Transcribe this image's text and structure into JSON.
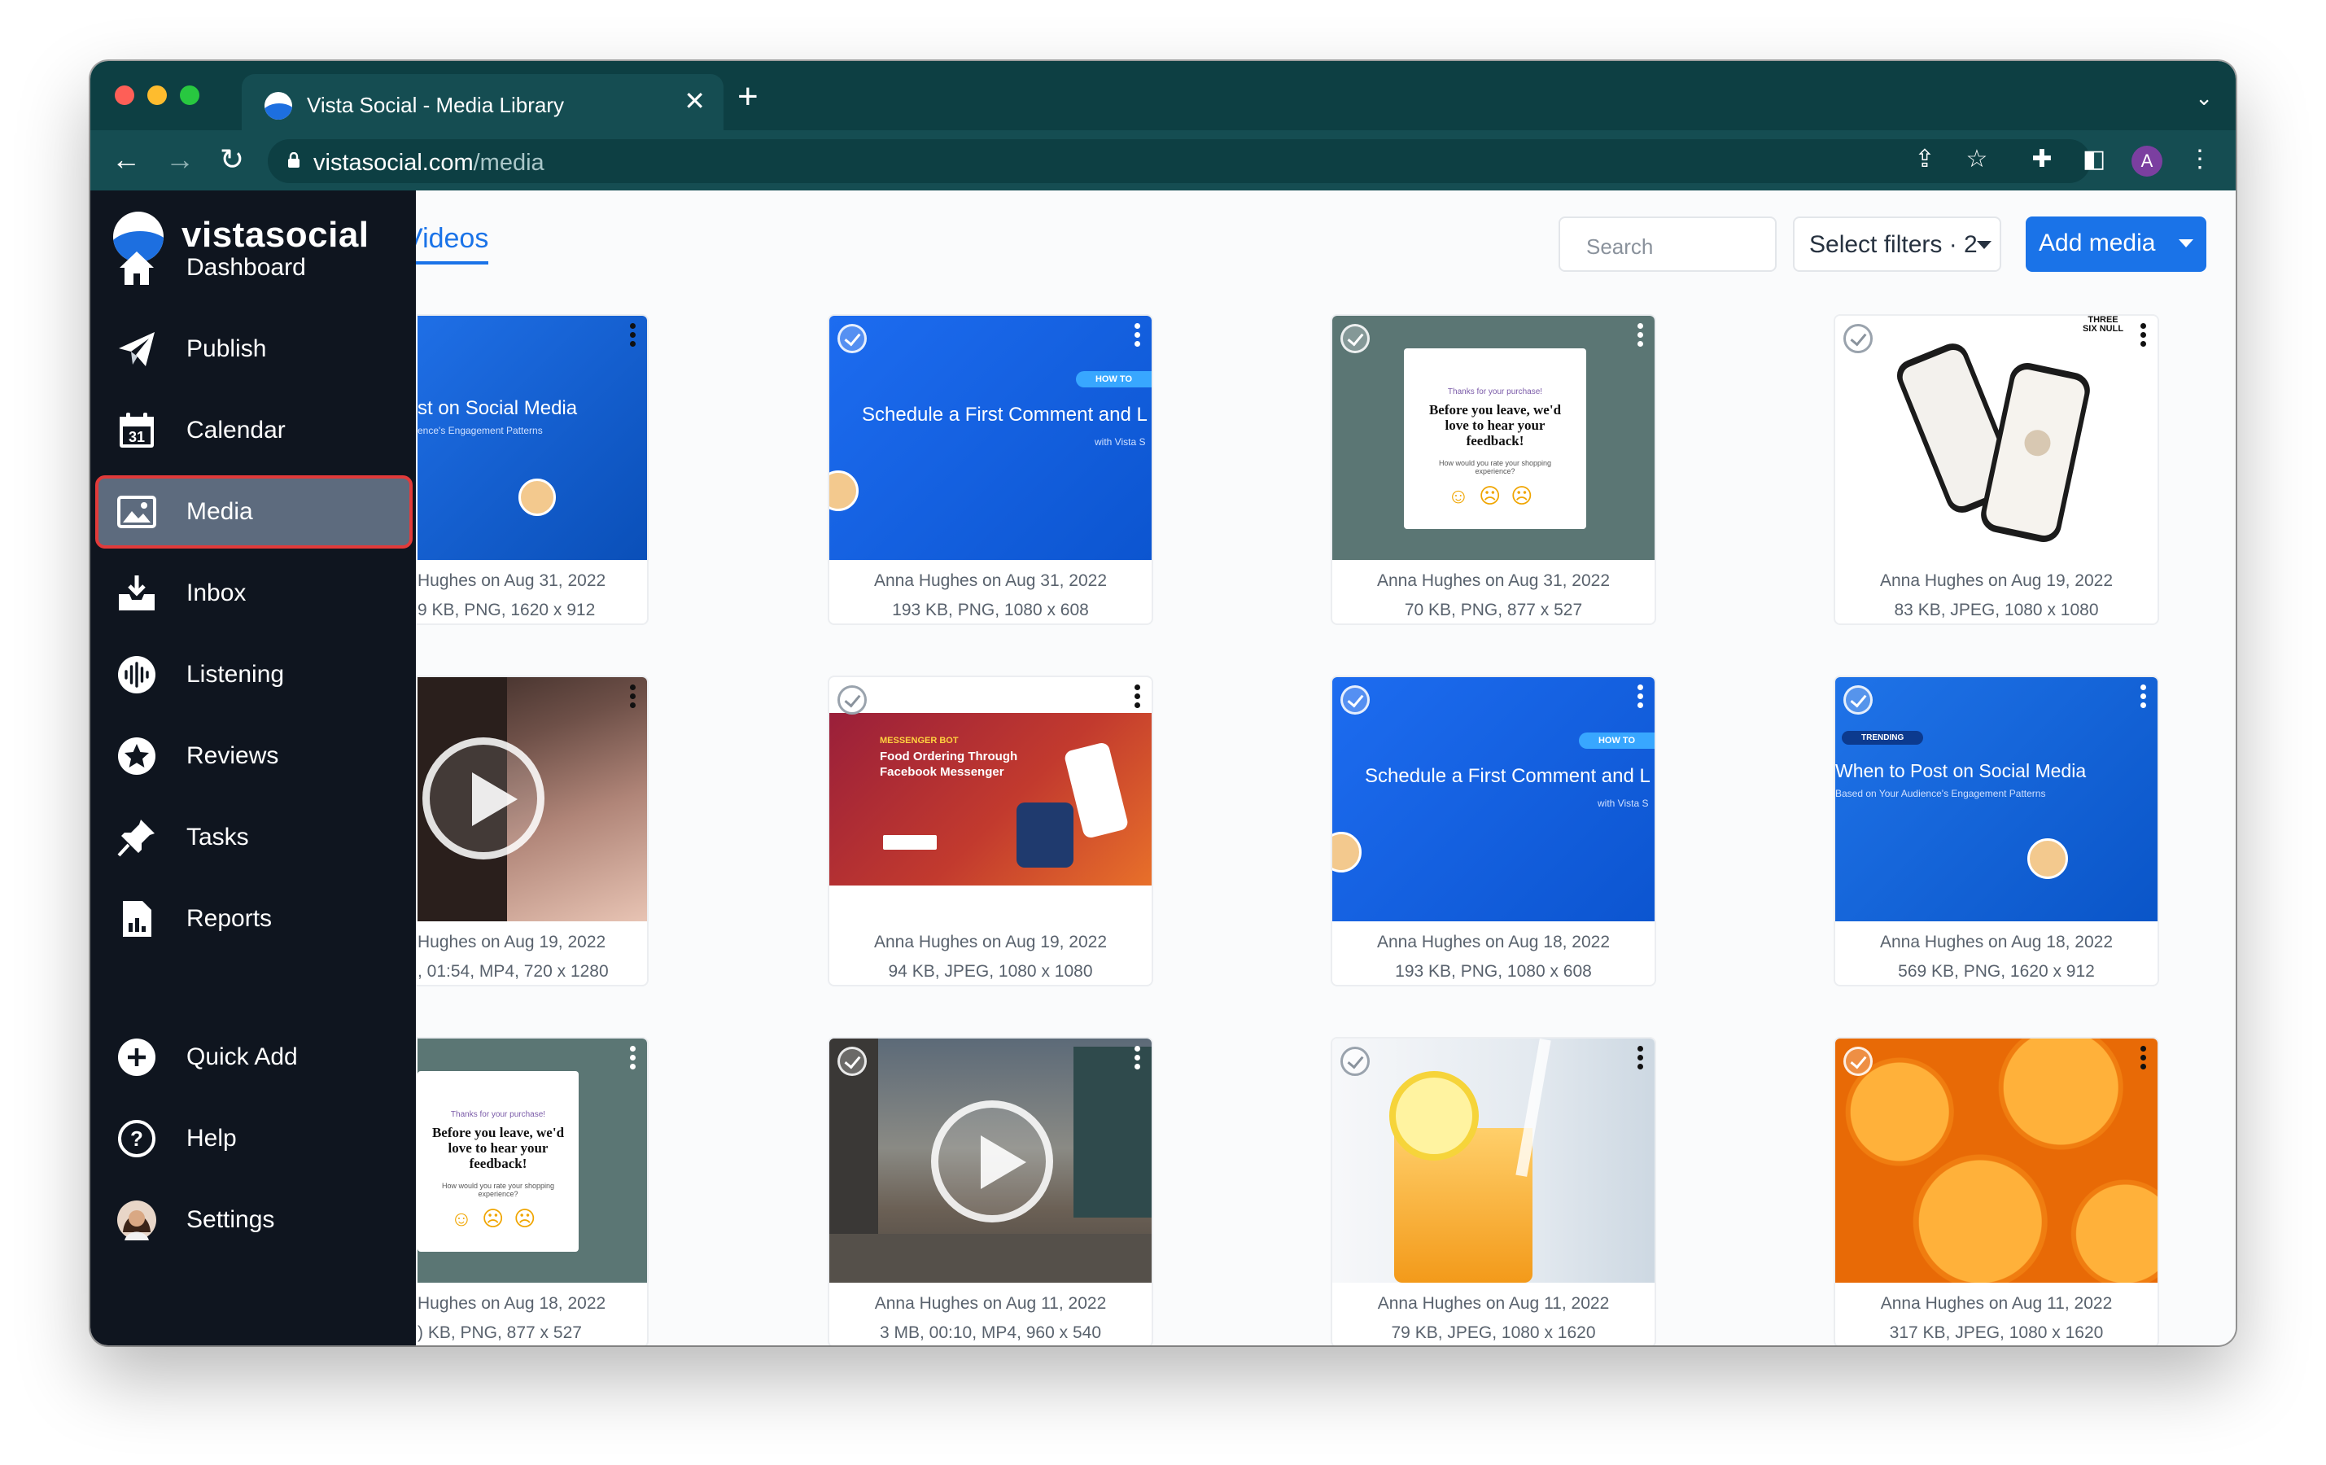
{
  "browser": {
    "tab_title": "Vista Social - Media Library",
    "url_host": "vistasocial.com",
    "url_path": "/media",
    "profile_initial": "A"
  },
  "sidebar": {
    "brand": "vistasocial",
    "items": [
      {
        "label": "Dashboard",
        "icon": "home-icon"
      },
      {
        "label": "Publish",
        "icon": "paper-plane-icon"
      },
      {
        "label": "Calendar",
        "icon": "calendar-icon"
      },
      {
        "label": "Media",
        "icon": "image-icon",
        "active": true
      },
      {
        "label": "Inbox",
        "icon": "inbox-icon"
      },
      {
        "label": "Listening",
        "icon": "sound-wave-icon"
      },
      {
        "label": "Reviews",
        "icon": "star-icon"
      },
      {
        "label": "Tasks",
        "icon": "pin-icon"
      },
      {
        "label": "Reports",
        "icon": "report-icon"
      }
    ],
    "bottom_items": [
      {
        "label": "Quick Add",
        "icon": "plus-circle-icon"
      },
      {
        "label": "Help",
        "icon": "help-icon"
      },
      {
        "label": "Settings",
        "icon": "avatar"
      }
    ]
  },
  "header": {
    "videos_tab": "Videos",
    "search_placeholder": "Search",
    "filters_label": "Select filters · 2",
    "add_media_label": "Add media"
  },
  "media": [
    {
      "meta1": "Hughes on Aug 31, 2022",
      "meta2": "9 KB, PNG, 1620 x 912",
      "kind": "slide",
      "caption": "st on Social Media",
      "sub": "ence's Engagement Patterns"
    },
    {
      "meta1": "Anna Hughes on Aug 31, 2022",
      "meta2": "193 KB, PNG, 1080 x 608",
      "kind": "slide",
      "caption": "Schedule a First Comment and L",
      "sub": "with Vista S",
      "badge": "HOW TO"
    },
    {
      "meta1": "Anna Hughes on Aug 31, 2022",
      "meta2": "70 KB, PNG, 877 x 527",
      "kind": "feedback",
      "caption": "Before you leave, we'd love to hear your feedback!",
      "sub": "How would you rate your shopping experience?",
      "top": "Thanks for your purchase!"
    },
    {
      "meta1": "Anna Hughes on Aug 19, 2022",
      "meta2": "83 KB, JPEG, 1080 x 1080",
      "kind": "phones",
      "caption": "THREE SIX NULL"
    },
    {
      "meta1": "Hughes on Aug 19, 2022",
      "meta2": ", 01:54, MP4, 720 x 1280",
      "kind": "video-person"
    },
    {
      "meta1": "Anna Hughes on Aug 19, 2022",
      "meta2": "94 KB, JPEG, 1080 x 1080",
      "kind": "messenger",
      "caption": "Food Ordering Through Facebook Messenger",
      "sub": "MESSENGER BOT"
    },
    {
      "meta1": "Anna Hughes on Aug 18, 2022",
      "meta2": "193 KB, PNG, 1080 x 608",
      "kind": "slide",
      "caption": "Schedule a First Comment and L",
      "sub": "with Vista S",
      "badge": "HOW TO"
    },
    {
      "meta1": "Anna Hughes on Aug 18, 2022",
      "meta2": "569 KB, PNG, 1620 x 912",
      "kind": "slide",
      "caption": "When to Post on Social Media",
      "sub": "Based on Your Audience's Engagement Patterns",
      "badge": "TRENDING"
    },
    {
      "meta1": "Hughes on Aug 18, 2022",
      "meta2": ") KB, PNG, 877 x 527",
      "kind": "feedback",
      "caption": "Before you leave, we'd love to hear your feedback!",
      "sub": "How would you rate your shopping experience?",
      "top": "Thanks for your purchase!"
    },
    {
      "meta1": "Anna Hughes on Aug 11, 2022",
      "meta2": "3 MB, 00:10, MP4, 960 x 540",
      "kind": "video-city"
    },
    {
      "meta1": "Anna Hughes on Aug 11, 2022",
      "meta2": "79 KB, JPEG, 1080 x 1620",
      "kind": "juice"
    },
    {
      "meta1": "Anna Hughes on Aug 11, 2022",
      "meta2": "317 KB, JPEG, 1080 x 1620",
      "kind": "oranges"
    }
  ],
  "colors": {
    "accent": "#1a73e8",
    "sidebar": "#0f151f",
    "chrome": "#0d3f43",
    "active_outline": "#e13a3a"
  }
}
